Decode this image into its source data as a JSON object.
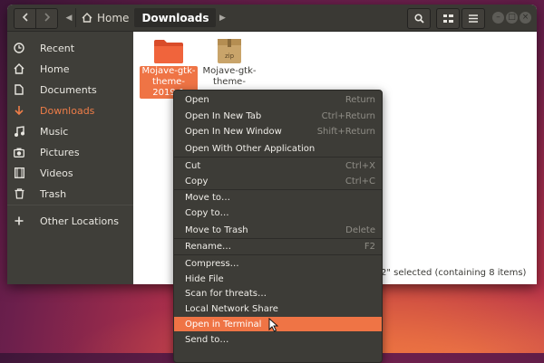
{
  "colors": {
    "accent": "#ef7445",
    "sidebar_bg": "#3f3e39",
    "header_bg": "#3a3934",
    "menu_bg": "#3d3c37"
  },
  "header": {
    "back_icon": "chevron-left-icon",
    "forward_icon": "chevron-right-icon",
    "breadcrumb": [
      {
        "label": "Home",
        "icon": "home-icon"
      },
      {
        "label": "Downloads"
      }
    ],
    "tools": [
      "search-icon",
      "view-grid-icon",
      "hamburger-menu-icon"
    ],
    "window_controls": [
      "minimize",
      "maximize",
      "close"
    ]
  },
  "sidebar": {
    "items": [
      {
        "label": "Recent",
        "icon": "clock-icon"
      },
      {
        "label": "Home",
        "icon": "home-icon"
      },
      {
        "label": "Documents",
        "icon": "document-icon"
      },
      {
        "label": "Downloads",
        "icon": "download-icon",
        "active": true
      },
      {
        "label": "Music",
        "icon": "music-note-icon"
      },
      {
        "label": "Pictures",
        "icon": "camera-icon"
      },
      {
        "label": "Videos",
        "icon": "film-icon"
      },
      {
        "label": "Trash",
        "icon": "trash-icon"
      },
      {
        "label": "Other Locations",
        "icon": "plus-icon"
      }
    ]
  },
  "files": [
    {
      "label": "Mojave-gtk-theme-2019-1",
      "icon": "folder-icon",
      "selected": true
    },
    {
      "label": "Mojave-gtk-theme-",
      "icon": "zip-archive-icon",
      "badge": "zip"
    }
  ],
  "status": {
    "text": "2\" selected  (containing 8 items)"
  },
  "context_menu": {
    "items": [
      {
        "label": "Open",
        "shortcut": "Return"
      },
      {
        "label": "Open In New Tab",
        "shortcut": "Ctrl+Return"
      },
      {
        "label": "Open In New Window",
        "shortcut": "Shift+Return"
      },
      {
        "label": "Open With Other Application",
        "shortcut": ""
      },
      {
        "label": "Cut",
        "shortcut": "Ctrl+X"
      },
      {
        "label": "Copy",
        "shortcut": "Ctrl+C"
      },
      {
        "label": "Move to…",
        "shortcut": ""
      },
      {
        "label": "Copy to…",
        "shortcut": ""
      },
      {
        "label": "Move to Trash",
        "shortcut": "Delete"
      },
      {
        "label": "Rename…",
        "shortcut": "F2"
      },
      {
        "label": "Compress…",
        "shortcut": ""
      },
      {
        "label": "Hide File",
        "shortcut": ""
      },
      {
        "label": "Scan for threats…",
        "shortcut": ""
      },
      {
        "label": "Local Network Share",
        "shortcut": ""
      },
      {
        "label": "Open in Terminal",
        "shortcut": "",
        "highlighted": true
      },
      {
        "label": "Send to…",
        "shortcut": ""
      }
    ]
  }
}
